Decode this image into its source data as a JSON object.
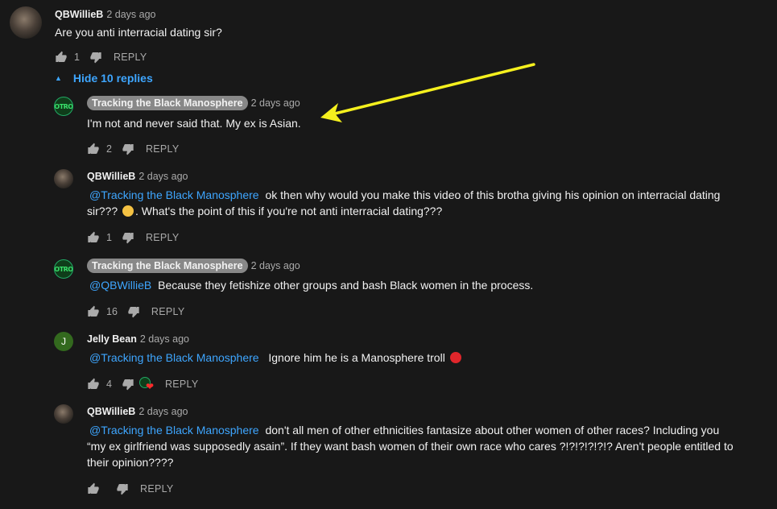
{
  "comments": [
    {
      "author": "QBWillieB",
      "time": "2 days ago",
      "text": "Are you anti interracial dating sir?",
      "likes": "1",
      "reply_label": "REPLY"
    },
    {
      "author": "Tracking the Black Manosphere",
      "time": "2 days ago",
      "text": "I'm not and never said that. My ex is Asian.",
      "likes": "2",
      "reply_label": "REPLY"
    },
    {
      "author": "QBWillieB",
      "time": "2 days ago",
      "mention": "@Tracking the Black Manosphere",
      "text_line1": "ok then why would you make this video of this brotha giving his opinion on interracial dating",
      "text_line2a": "sir??? ",
      "text_line2b": ". What's the point of this if you're not anti interracial dating???",
      "likes": "1",
      "reply_label": "REPLY"
    },
    {
      "author": "Tracking the Black Manosphere",
      "time": "2 days ago",
      "mention": "@QBWillieB",
      "text": "Because they fetishize other groups and bash Black women in the process.",
      "likes": "16",
      "reply_label": "REPLY"
    },
    {
      "author": "Jelly Bean",
      "avatar_letter": "J",
      "time": "2 days ago",
      "mention": "@Tracking the Black Manosphere",
      "text": "Ignore him he is a Manosphere troll",
      "likes": "4",
      "reply_label": "REPLY"
    },
    {
      "author": "QBWillieB",
      "time": "2 days ago",
      "mention": "@Tracking the Black Manosphere",
      "text_line1": "don't all men of other ethnicities fantasize about other women of other races? Including you",
      "text_line2": "“my ex girlfriend was supposedly asain”. If they want bash women of their own race who cares ?!?!?!?!?!? Aren't people entitled to",
      "text_line3": "their opinion????",
      "likes": "",
      "reply_label": "REPLY"
    }
  ],
  "hide_replies_label": "Hide 10 replies",
  "tbm_avatar_text": "OTRO",
  "colors": {
    "background": "#181818",
    "link": "#3ea6ff",
    "muted": "#aaaaaa",
    "annotation_arrow": "#f5f01e"
  },
  "icons": [
    "thumbs-up-icon",
    "thumbs-down-icon",
    "chevron-up-icon",
    "heart-icon",
    "annotation-arrow"
  ]
}
